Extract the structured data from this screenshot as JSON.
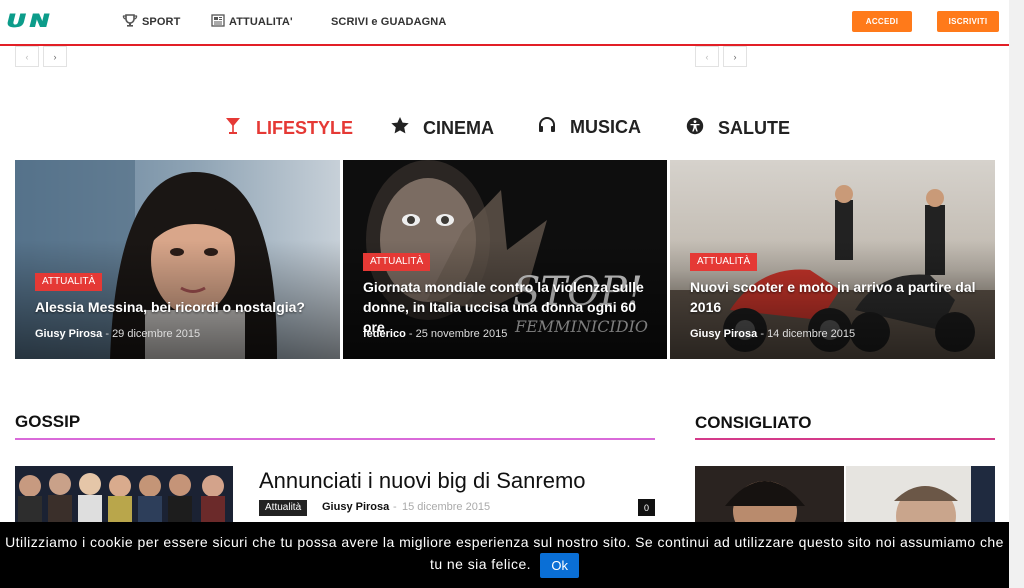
{
  "header": {
    "logo": "UN",
    "nav": [
      {
        "label": "SPORT",
        "icon": "trophy-icon"
      },
      {
        "label": "ATTUALITA'",
        "icon": "newspaper-icon"
      },
      {
        "label": "SCRIVI e GUADAGNA",
        "icon": ""
      }
    ],
    "login_label": "ACCEDI",
    "register_label": "ISCRIVITI",
    "accent": "#ff7a1a",
    "divider_color": "#e21f26"
  },
  "category_tabs": [
    {
      "label": "LIFESTYLE",
      "icon": "cocktail-icon",
      "active": true
    },
    {
      "label": "CINEMA",
      "icon": "star-icon",
      "active": false
    },
    {
      "label": "MUSICA",
      "icon": "headphones-icon",
      "active": false
    },
    {
      "label": "SALUTE",
      "icon": "accessibility-icon",
      "active": false
    }
  ],
  "featured": [
    {
      "category": "ATTUALITÀ",
      "title": "Alessia Messina, bei ricordi o nostalgia?",
      "author": "Giusy Pirosa",
      "date": "29 dicembre 2015"
    },
    {
      "category": "ATTUALITÀ",
      "title": "Giornata mondiale contro la violenza sulle donne, in Italia uccisa una donna ogni 60 ore",
      "author": "federico",
      "date": "25 novembre 2015",
      "image_text": "STOP FEMMINICIDIO!"
    },
    {
      "category": "ATTUALITÀ",
      "title": "Nuovi scooter e moto in arrivo a partire dal 2016",
      "author": "Giusy Pirosa",
      "date": "14 dicembre 2015"
    }
  ],
  "gossip": {
    "title": "GOSSIP",
    "line_color": "#d96ad9",
    "article": {
      "title": "Annunciati i nuovi big di Sanremo",
      "category": "Attualità",
      "author": "Giusy Pirosa",
      "separator": "-",
      "date": "15 dicembre 2015",
      "comments": "0"
    }
  },
  "recommended": {
    "title": "CONSIGLIATO",
    "line_color": "#d43a8a"
  },
  "cookie": {
    "text": "Utilizziamo i cookie per essere sicuri che tu possa avere la migliore esperienza sul nostro sito. Se continui ad utilizzare questo sito noi assumiamo che tu ne sia felice.",
    "ok_label": "Ok"
  },
  "pager": {
    "prev": "‹",
    "next": "›"
  }
}
